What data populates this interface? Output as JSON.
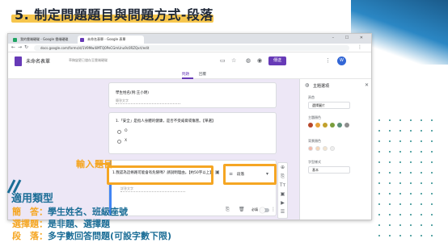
{
  "slide": {
    "title": "5. 制定問題題目與問題方式-段落",
    "input_annotation": "輸入題目",
    "types_heading": "適用類型",
    "types": [
      {
        "key": "簡　答：",
        "value": "學生姓名、班級座號"
      },
      {
        "key": "選擇題：",
        "value": "是非題、選擇題"
      },
      {
        "key": "段　落：",
        "value": "多字數回答問題(可設字數下限)"
      }
    ]
  },
  "browser": {
    "tabs": [
      "我的雲端硬碟 - Google 雲端硬碟",
      "未命名表單 - Google 表單"
    ],
    "url": "docs.google.com/forms/d/1V9Mw4iMTQ0PeCGmUnu9c0RZQxrI/edit",
    "window_controls": "– ☐ ✕"
  },
  "form_app": {
    "form_name": "未命名表單",
    "save_note": "草稿變更已儲存至雲端硬碟",
    "send_label": "傳送",
    "avatar_letter": "W",
    "tab_questions": "問題",
    "tab_responses": "回覆",
    "q1": {
      "title": "學生姓名(例:王小明)",
      "hint": "簡答文字"
    },
    "q2": {
      "title": "1.「安全」是指人身體的健康，是否不受威脅或傷害。【單選】",
      "options": [
        "O",
        "X"
      ]
    },
    "q3": {
      "title": "1.我認為這條路可能會有危險嗎？請說明理由。【約50字以上】",
      "hint": "詳答文字",
      "type_label": "段落",
      "required_label": "必填"
    },
    "float_tool_icons": [
      "⊕",
      "⎘",
      "Tт",
      "▣",
      "▶",
      "☰"
    ]
  },
  "theme_panel": {
    "title": "主題選項",
    "header_label": "頁首",
    "header_button": "選擇圖片",
    "theme_color_label": "主題顏色",
    "bg_color_label": "背景顏色",
    "font_label": "字型樣式",
    "font_value": "基本",
    "theme_colors": [
      "#b7472a",
      "#e8a33c",
      "#c2a12c",
      "#7a9e3c",
      "#5e8f7a",
      "#8e8e8e"
    ],
    "bg_colors": [
      "#f4b8a8",
      "#f6d6b8",
      "#f3e4cf",
      "#eeeeee"
    ]
  }
}
